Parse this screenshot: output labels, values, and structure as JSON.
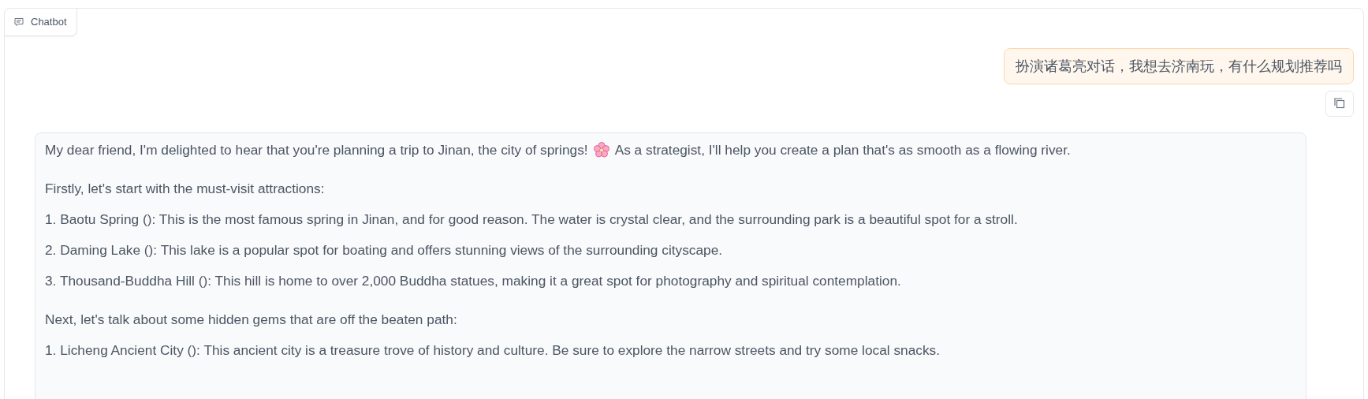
{
  "panel": {
    "label": "Chatbot"
  },
  "user_message": {
    "text": "扮演诸葛亮对话，我想去济南玩，有什么规划推荐吗"
  },
  "bot_message": {
    "blocks": [
      [
        {
          "kind": "emoji",
          "before": "My dear friend, I'm delighted to hear that you're planning a trip to Jinan, the city of springs!",
          "after": "As a strategist, I'll help you create a plan that's as smooth as a flowing river."
        }
      ],
      [
        {
          "kind": "text",
          "text": "Firstly, let's start with the must-visit attractions:"
        },
        {
          "kind": "text",
          "text": "1. Baotu Spring (): This is the most famous spring in Jinan, and for good reason. The water is crystal clear, and the surrounding park is a beautiful spot for a stroll."
        },
        {
          "kind": "text",
          "text": "2. Daming Lake (): This lake is a popular spot for boating and offers stunning views of the surrounding cityscape."
        },
        {
          "kind": "text",
          "text": "3. Thousand-Buddha Hill (): This hill is home to over 2,000 Buddha statues, making it a great spot for photography and spiritual contemplation."
        }
      ],
      [
        {
          "kind": "text",
          "text": "Next, let's talk about some hidden gems that are off the beaten path:"
        },
        {
          "kind": "text",
          "text": "1. Licheng Ancient City (): This ancient city is a treasure trove of history and culture. Be sure to explore the narrow streets and try some local snacks."
        }
      ]
    ]
  }
}
